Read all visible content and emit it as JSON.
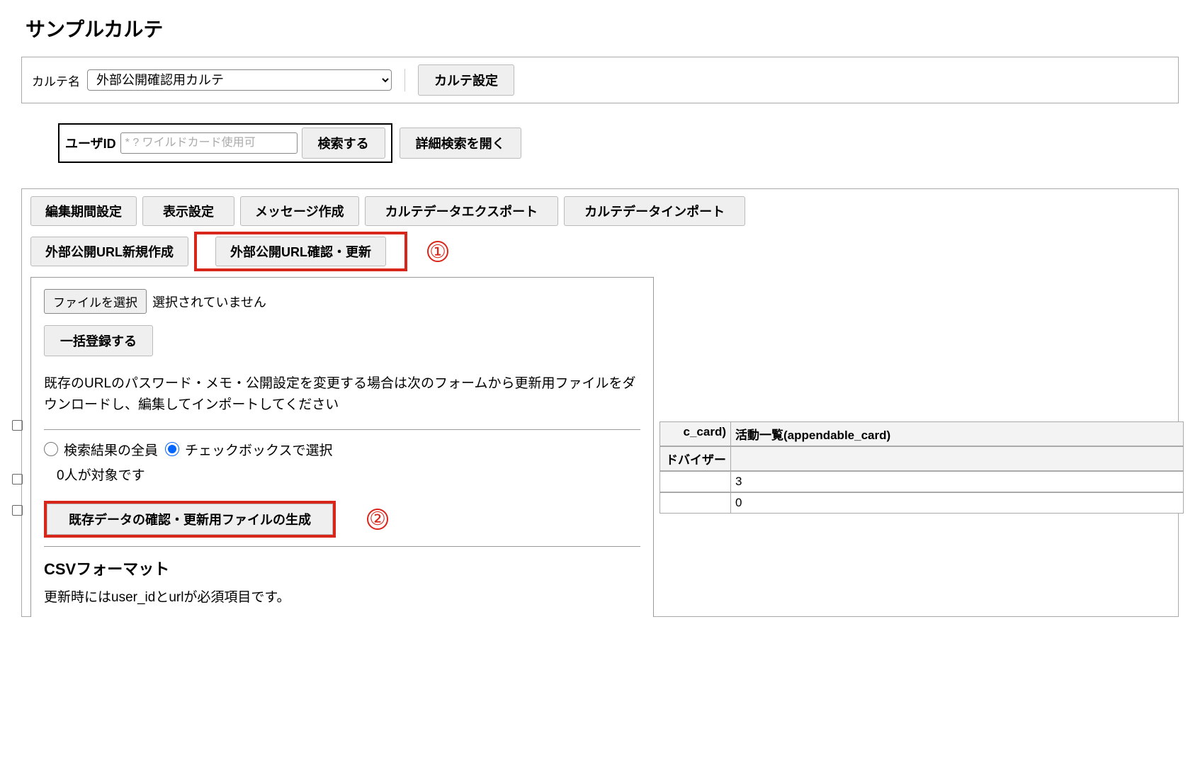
{
  "page_title": "サンプルカルテ",
  "top_bar": {
    "karte_name_label": "カルテ名",
    "karte_select_value": "外部公開確認用カルテ",
    "karte_settings_btn": "カルテ設定"
  },
  "search": {
    "user_id_label": "ユーザID",
    "user_id_placeholder": "* ? ワイルドカード使用可",
    "search_btn": "検索する",
    "adv_search_btn": "詳細検索を開く"
  },
  "tabs": {
    "row1": [
      "編集期間設定",
      "表示設定",
      "メッセージ作成",
      "カルテデータエクスポート",
      "カルテデータインポート"
    ],
    "row2": [
      "外部公開URL新規作成",
      "外部公開URL確認・更新"
    ]
  },
  "anno": {
    "a1": "①",
    "a2": "②"
  },
  "popup": {
    "file_select_btn": "ファイルを選択",
    "file_status": "選択されていません",
    "bulk_register_btn": "一括登録する",
    "desc": "既存のURLのパスワード・メモ・公開設定を変更する場合は次のフォームから更新用ファイルをダウンロードし、編集してインポートしてください",
    "radio1": "検索結果の全員",
    "radio2": "チェックボックスで選択",
    "count_text": "0人が対象です",
    "generate_btn": "既存データの確認・更新用ファイルの生成",
    "csv_heading": "CSVフォーマット",
    "csv_desc": "更新時にはuser_idとurlが必須項目です。"
  },
  "bg_table": {
    "th_c1_frag": "c_card)",
    "th_c2": "活動一覧(appendable_card)",
    "th2_c1_frag": "ドバイザー",
    "r1_c2": "3",
    "r2_c2": "0"
  }
}
